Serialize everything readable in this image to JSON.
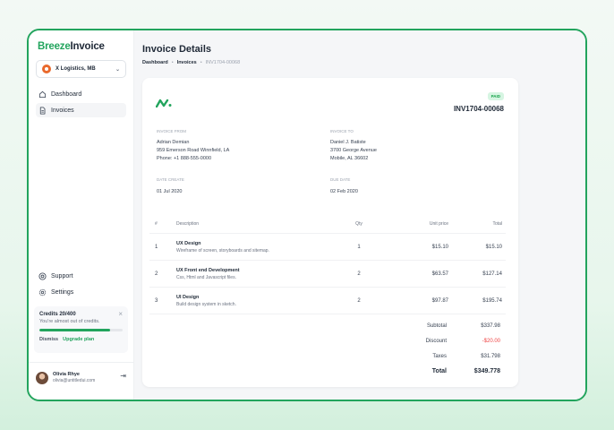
{
  "sidebar": {
    "brand_part1": "Breeze",
    "brand_part2": "Invoice",
    "org_name": "X Logistics, MB",
    "nav": [
      {
        "label": "Dashboard",
        "icon": "home-icon"
      },
      {
        "label": "Invoices",
        "icon": "document-icon"
      }
    ],
    "bottom_nav": [
      {
        "label": "Support",
        "icon": "support-icon"
      },
      {
        "label": "Settings",
        "icon": "gear-icon"
      }
    ],
    "credits": {
      "title": "Credits 20/400",
      "subtitle": "You're almost out of credits.",
      "progress": 0.85,
      "dismiss": "Dismiss",
      "upgrade": "Upgrade plan"
    },
    "user": {
      "name": "Olivia Rhye",
      "email": "olivia@untitledui.com"
    }
  },
  "header": {
    "title": "Invoice Details",
    "breadcrumb": [
      "Dashboard",
      "Invoices",
      "INV1704-00068"
    ]
  },
  "invoice": {
    "status": "PAID",
    "number": "INV1704-00068",
    "from_label": "INVOICE FROM",
    "from": [
      "Adrian Demian",
      "959 Emerson Road Winnfield, LA",
      "Phone: +1 888-555-0000"
    ],
    "to_label": "INVOICE TO",
    "to": [
      "Daniel J. Batiste",
      "3700 George Avenue",
      "Mobile, AL 36602"
    ],
    "date_create_label": "DATE CREATE",
    "date_create": "01 Jul 2020",
    "due_date_label": "DUE DATE",
    "due_date": "02 Feb 2020",
    "table": {
      "headers": [
        "#",
        "Description",
        "Qty",
        "Unit price",
        "Total"
      ],
      "rows": [
        {
          "num": "1",
          "title": "UX Design",
          "desc": "Wireframe of screen, storyboards and sitemap.",
          "qty": "1",
          "unit": "$15.10",
          "total": "$15.10"
        },
        {
          "num": "2",
          "title": "UX Front end Development",
          "desc": "Css, Html and Javascript files.",
          "qty": "2",
          "unit": "$63.57",
          "total": "$127.14"
        },
        {
          "num": "3",
          "title": "UI Design",
          "desc": "Build design system in sketch.",
          "qty": "2",
          "unit": "$97.87",
          "total": "$195.74"
        }
      ]
    },
    "summary": {
      "subtotal_label": "Subtotal",
      "subtotal": "$337.98",
      "discount_label": "Discount",
      "discount": "-$20.00",
      "taxes_label": "Taxes",
      "taxes": "$31.798",
      "total_label": "Total",
      "total": "$349.778"
    }
  },
  "colors": {
    "accent": "#22a45d",
    "danger": "#ef4444",
    "paid_badge_bg": "#d6f5e2"
  }
}
